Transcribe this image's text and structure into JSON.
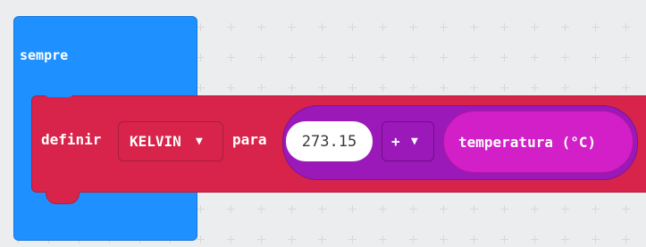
{
  "workspace": {
    "background": "#ecedef"
  },
  "forever_block": {
    "label": "sempre",
    "color": "#1e90ff"
  },
  "set_block": {
    "label": "definir",
    "variable": "KELVIN",
    "to_label": "para",
    "color": "#d8244a",
    "caret_icon": "caret-down-icon"
  },
  "math_block": {
    "color": "#9b19b8",
    "left_value": "273.15",
    "operator": "+",
    "operator_caret_icon": "caret-down-icon"
  },
  "temperature_block": {
    "label": "temperatura (°C)",
    "color": "#d21fc7"
  }
}
